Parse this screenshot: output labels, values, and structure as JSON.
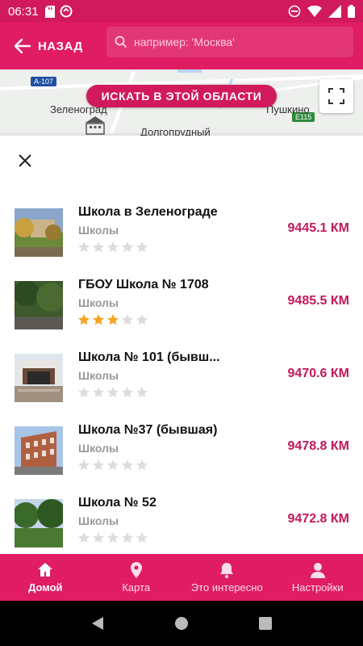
{
  "status_bar": {
    "time": "06:31"
  },
  "header": {
    "back_label": "НАЗАД",
    "search_placeholder": "например: 'Москва'"
  },
  "map": {
    "labels": [
      "Зеленоград",
      "Долгопрудный",
      "Пушкино"
    ],
    "road_shields": [
      "A-107",
      "E115"
    ],
    "search_area_label": "ИСКАТЬ В ЭТОЙ ОБЛАСТИ"
  },
  "results": [
    {
      "name": "Школа в Зеленограде",
      "category": "Школы",
      "rating": 0,
      "distance": "9445.1 КМ"
    },
    {
      "name": "ГБОУ Школа № 1708",
      "category": "Школы",
      "rating": 3,
      "distance": "9485.5 КМ"
    },
    {
      "name": "Школа № 101 (бывш...",
      "category": "Школы",
      "rating": 0,
      "distance": "9470.6 КМ"
    },
    {
      "name": "Школа №37 (бывшая)",
      "category": "Школы",
      "rating": 0,
      "distance": "9478.8 КМ"
    },
    {
      "name": "Школа № 52",
      "category": "Школы",
      "rating": 0,
      "distance": "9472.8 КМ"
    }
  ],
  "bottom_nav": {
    "items": [
      {
        "label": "Домой",
        "icon": "home-icon",
        "active": true
      },
      {
        "label": "Карта",
        "icon": "map-pin-icon",
        "active": false
      },
      {
        "label": "Это интересно",
        "icon": "bell-icon",
        "active": false
      },
      {
        "label": "Настройки",
        "icon": "person-icon",
        "active": false
      }
    ]
  },
  "colors": {
    "brand": "#e01c62",
    "status_bar": "#d11a5c",
    "distance": "#c2185b",
    "star_filled": "#f5a623",
    "star_empty": "#dddddd"
  }
}
